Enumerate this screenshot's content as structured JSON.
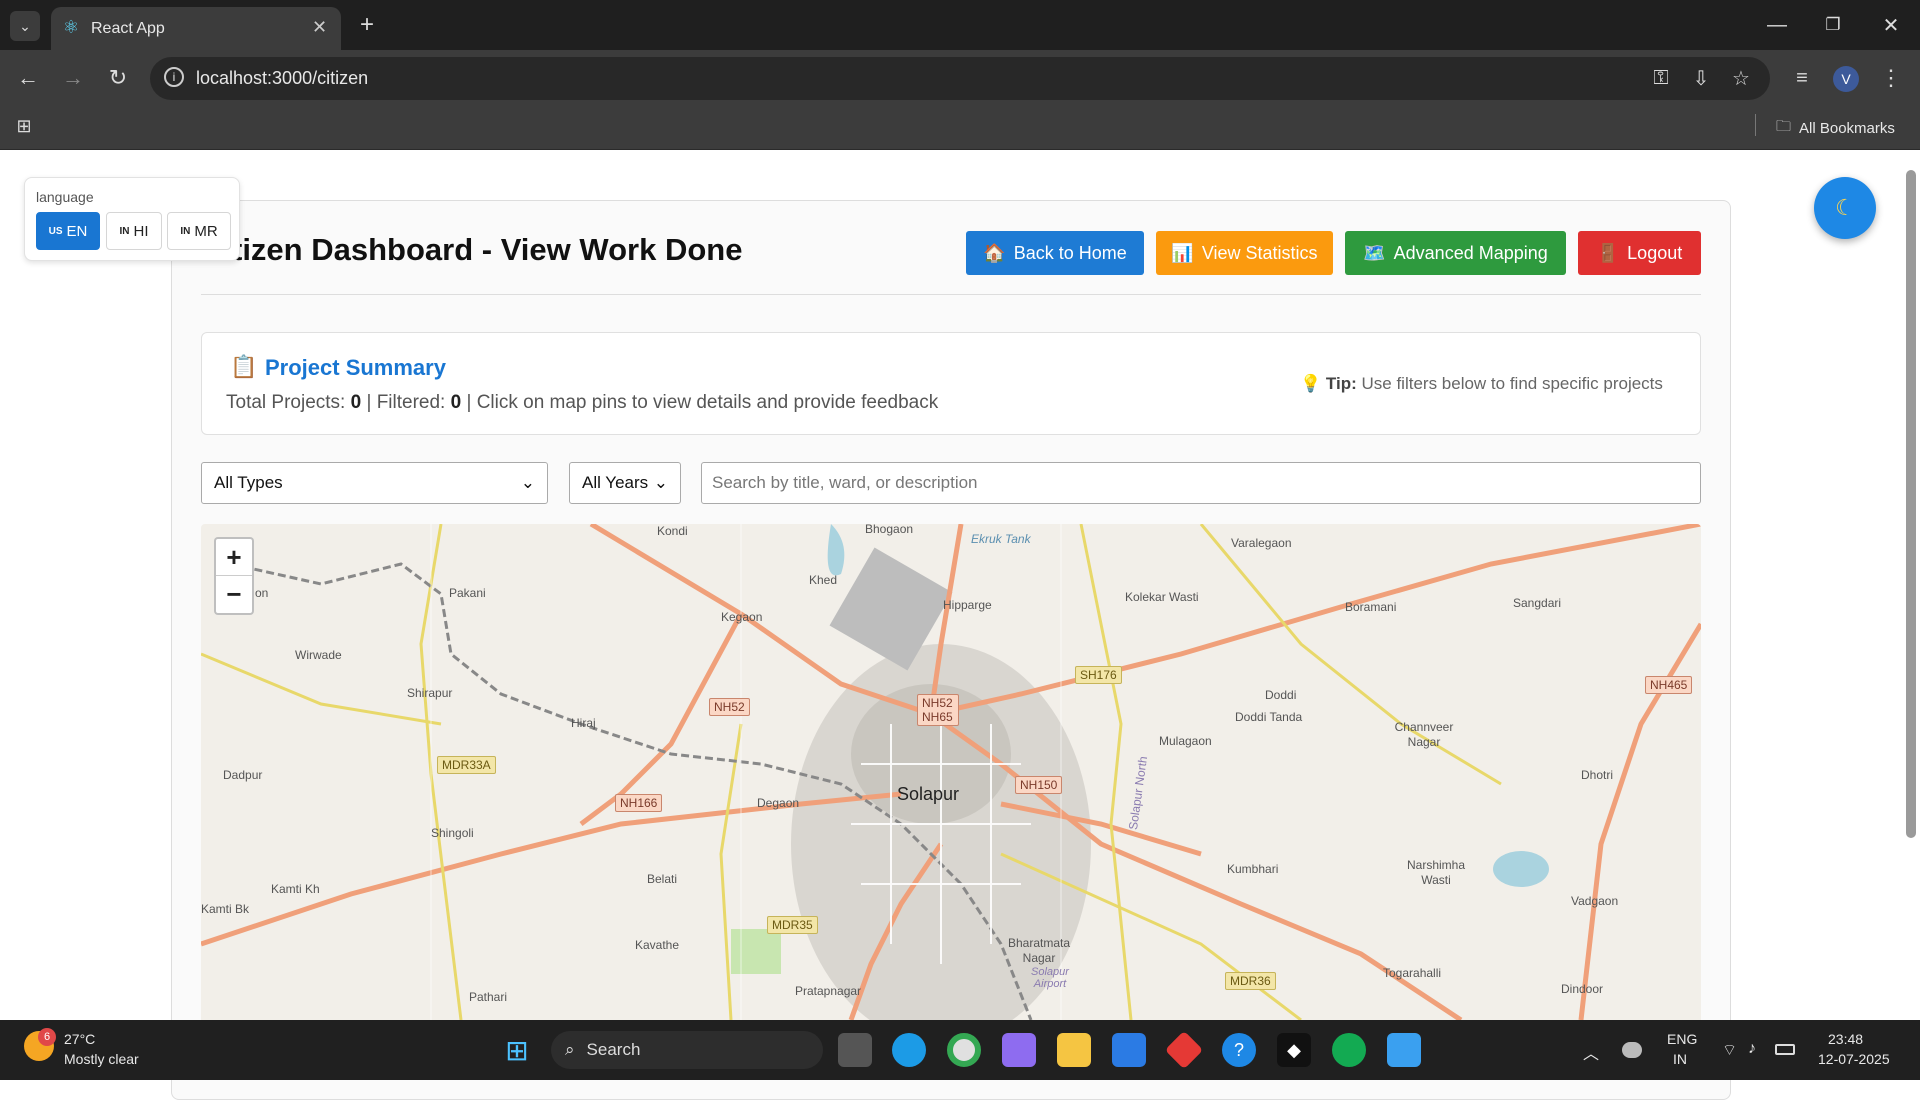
{
  "browser": {
    "tab_title": "React App",
    "url": "localhost:3000/citizen",
    "bookmarks_label": "All Bookmarks",
    "profile_initial": "V"
  },
  "language": {
    "label": "language",
    "options": [
      {
        "flag": "US",
        "code": "EN",
        "active": true
      },
      {
        "flag": "IN",
        "code": "HI",
        "active": false
      },
      {
        "flag": "IN",
        "code": "MR",
        "active": false
      }
    ]
  },
  "header": {
    "title": "Citizen Dashboard - View Work Done",
    "buttons": [
      {
        "icon": "🏠",
        "label": "Back to Home",
        "color": "#1e7bd4"
      },
      {
        "icon": "📊",
        "label": "View Statistics",
        "color": "#fb9a0e"
      },
      {
        "icon": "🗺️",
        "label": "Advanced Mapping",
        "color": "#2e9a3e"
      },
      {
        "icon": "🚪",
        "label": "Logout",
        "color": "#e03030"
      }
    ]
  },
  "summary": {
    "icon": "📋",
    "title": "Project Summary",
    "total_label": "Total Projects:",
    "total_value": "0",
    "filtered_label": "Filtered:",
    "filtered_value": "0",
    "hint": "Click on map pins to view details and provide feedback",
    "tip_icon": "💡",
    "tip_label": "Tip:",
    "tip_text": "Use filters below to find specific projects"
  },
  "filters": {
    "type_selected": "All Types",
    "year_selected": "All Years",
    "search_placeholder": "Search by title, ward, or description"
  },
  "map": {
    "zoom_in": "+",
    "zoom_out": "−",
    "places": [
      "Kondi",
      "Bhogaon",
      "Ekruk Tank",
      "Varalegaon",
      "Pakani",
      "Khed",
      "Hipparge",
      "Kolekar Wasti",
      "Boramani",
      "Sangdari",
      "Kegaon",
      "Wirwade",
      "SH176",
      "Shirapur",
      "Hiraj",
      "NH52",
      "NH52 NH65",
      "Doddi",
      "Doddi Tanda",
      "Channveer Nagar",
      "NH465",
      "Mulagaon",
      "MDR33A",
      "Dadpur",
      "NH150",
      "Solapur North",
      "Dhotri",
      "NH166",
      "Degaon",
      "Solapur",
      "Shingoli",
      "Narshimha Wasti",
      "Kumbhari",
      "Belati",
      "Kamti Kh",
      "Kamti Bk",
      "Vadgaon",
      "MDR35",
      "Bharatmata Nagar",
      "Solapur Airport",
      "Kavathe",
      "Togarahalli",
      "MDR36",
      "Pratapnagar",
      "Dindoor",
      "Pathari",
      "on"
    ]
  },
  "taskbar": {
    "weather_temp": "27°C",
    "weather_desc": "Mostly clear",
    "weather_badge": "6",
    "search_label": "Search",
    "lang1": "ENG",
    "lang2": "IN",
    "time": "23:48",
    "date": "12-07-2025"
  }
}
